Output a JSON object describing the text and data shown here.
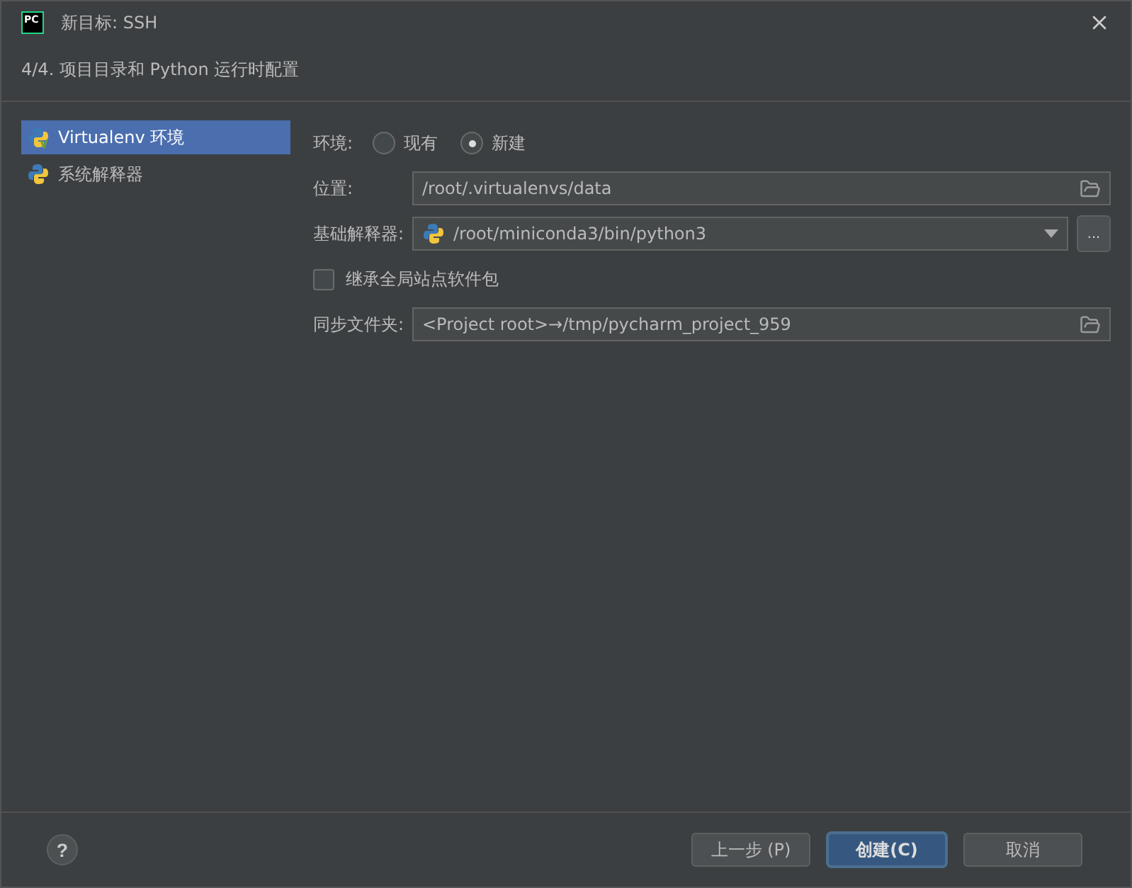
{
  "window": {
    "title": "新目标: SSH",
    "logo": "PC"
  },
  "step": "4/4. 项目目录和 Python 运行时配置",
  "sidebar": {
    "items": [
      {
        "label": "Virtualenv 环境",
        "kind": "venv",
        "selected": true
      },
      {
        "label": "系统解释器",
        "kind": "system",
        "selected": false
      }
    ]
  },
  "form": {
    "environment": {
      "label": "环境:",
      "options": [
        {
          "label": "现有",
          "selected": false
        },
        {
          "label": "新建",
          "selected": true
        }
      ]
    },
    "location": {
      "label": "位置:",
      "value": "/root/.virtualenvs/data"
    },
    "base_interpreter": {
      "label": "基础解释器:",
      "value": "/root/miniconda3/bin/python3",
      "browse": "..."
    },
    "inherit": {
      "label": "继承全局站点软件包",
      "checked": false
    },
    "sync_folder": {
      "label": "同步文件夹:",
      "value": "<Project root>→/tmp/pycharm_project_959"
    }
  },
  "footer": {
    "help": "?",
    "buttons": [
      {
        "label": "上一步 (P)",
        "default": false
      },
      {
        "label": "创建(C)",
        "default": true
      },
      {
        "label": "取消",
        "default": false
      }
    ]
  }
}
